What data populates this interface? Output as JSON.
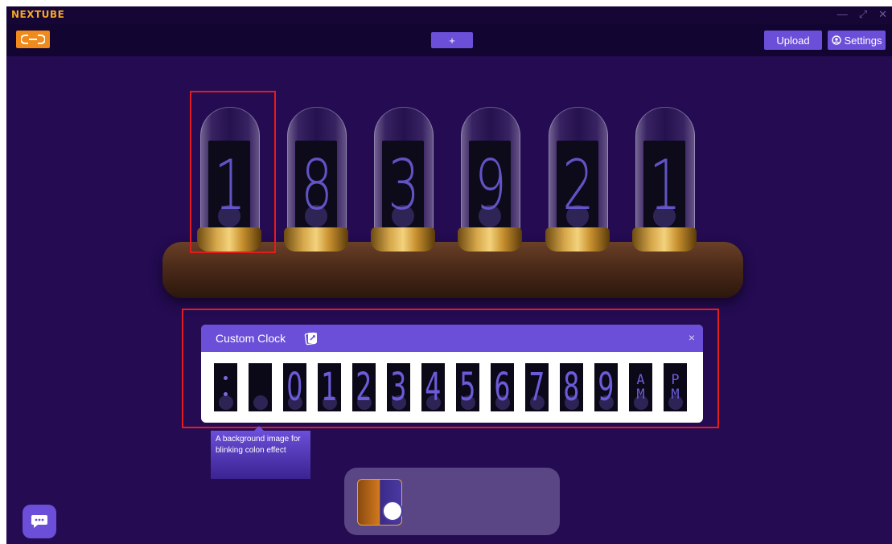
{
  "app": {
    "name": "NEXTUBE"
  },
  "window_controls": {
    "minimize": "—",
    "restore": "⤢",
    "close": "✕"
  },
  "toolbar": {
    "add_label": "+",
    "upload_label": "Upload",
    "settings_label": "Settings"
  },
  "tubes": [
    {
      "digit": "1"
    },
    {
      "digit": "8"
    },
    {
      "digit": "3"
    },
    {
      "digit": "9"
    },
    {
      "digit": "2"
    },
    {
      "digit": "1"
    }
  ],
  "custom_clock": {
    "title": "Custom Clock",
    "close": "×",
    "tiles": [
      {
        "kind": "colon"
      },
      {
        "kind": "blank"
      },
      {
        "kind": "digit",
        "label": "0"
      },
      {
        "kind": "digit",
        "label": "1"
      },
      {
        "kind": "digit",
        "label": "2"
      },
      {
        "kind": "digit",
        "label": "3"
      },
      {
        "kind": "digit",
        "label": "4"
      },
      {
        "kind": "digit",
        "label": "5"
      },
      {
        "kind": "digit",
        "label": "6"
      },
      {
        "kind": "digit",
        "label": "7"
      },
      {
        "kind": "digit",
        "label": "8"
      },
      {
        "kind": "digit",
        "label": "9"
      },
      {
        "kind": "ampm",
        "top": "A",
        "bottom": "M"
      },
      {
        "kind": "ampm",
        "top": "P",
        "bottom": "M"
      }
    ]
  },
  "tooltip": {
    "text": "A background image for blinking colon effect"
  },
  "colors": {
    "background": "#240b52",
    "accent": "#6b4fd8",
    "logo": "#f08a1c",
    "highlight": "#e11d1d"
  },
  "icons": {
    "logo": "link-logo-icon",
    "settings": "settings-circle-icon",
    "panel": "card-edit-icon",
    "chat": "chat-icon"
  }
}
